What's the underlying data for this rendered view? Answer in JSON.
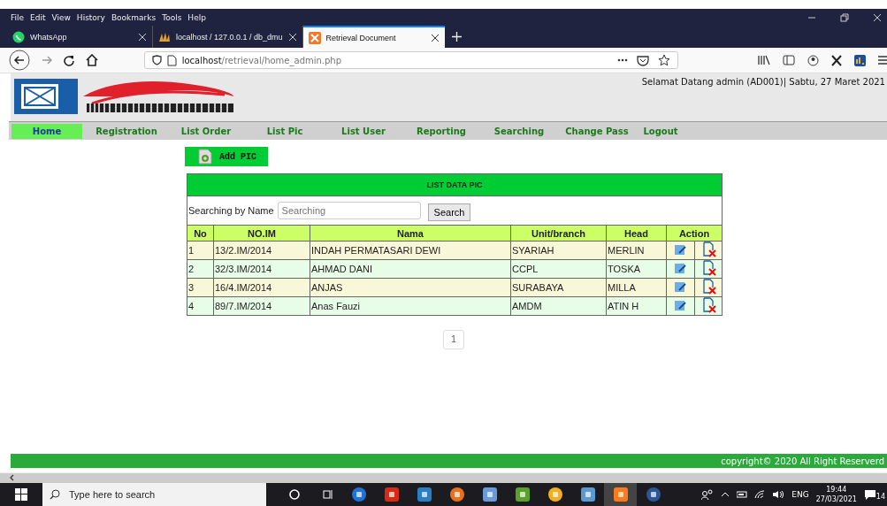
{
  "browser": {
    "menu": [
      "File",
      "Edit",
      "View",
      "History",
      "Bookmarks",
      "Tools",
      "Help"
    ],
    "tabs": [
      {
        "title": "WhatsApp",
        "selected": false
      },
      {
        "title": "localhost / 127.0.0.1 / db_dmu",
        "selected": false
      },
      {
        "title": "Retrieval Document",
        "selected": true
      }
    ],
    "url": {
      "host": "localhost",
      "path": "/retrieval/home_admin.php"
    }
  },
  "header": {
    "welcome": "Selamat Datang admin (AD001)| Sabtu, 27 Maret 2021"
  },
  "nav": [
    {
      "label": "Home",
      "selected": true
    },
    {
      "label": "Registration",
      "selected": false
    },
    {
      "label": "List Order",
      "selected": false
    },
    {
      "label": "List Pic",
      "selected": false
    },
    {
      "label": "List User",
      "selected": false
    },
    {
      "label": "Reporting",
      "selected": false
    },
    {
      "label": "Searching",
      "selected": false
    },
    {
      "label": "Change Pass",
      "selected": false
    },
    {
      "label": "Logout",
      "selected": false
    }
  ],
  "add_button": "Add PIC",
  "table": {
    "title": "LIST DATA PIC",
    "search_label": "Searching by Name",
    "search": {
      "placeholder": "Searching"
    },
    "search_button": "Search",
    "columns": [
      "No",
      "NO.IM",
      "Nama",
      "Unit/branch",
      "Head",
      "Action"
    ],
    "rows": [
      [
        "1",
        "13/2.IM/2014",
        "INDAH PERMATASARI DEWI",
        "SYARIAH",
        "MERLIN"
      ],
      [
        "2",
        "32/3.IM/2014",
        "AHMAD DANI",
        "CCPL",
        "TOSKA"
      ],
      [
        "3",
        "16/4.IM/2014",
        "ANJAS",
        "SURABAYA",
        "MILLA"
      ],
      [
        "4",
        "89/7.IM/2014",
        "Anas Fauzi",
        "AMDM",
        "ATIN H"
      ]
    ]
  },
  "pagination": [
    "1"
  ],
  "footer": "copyright© 2020 All Right Reserverd",
  "taskbar": {
    "search_placeholder": "Type here to search",
    "language": "ENG",
    "time": "19:44",
    "date": "27/03/2021",
    "notifications": "14"
  }
}
